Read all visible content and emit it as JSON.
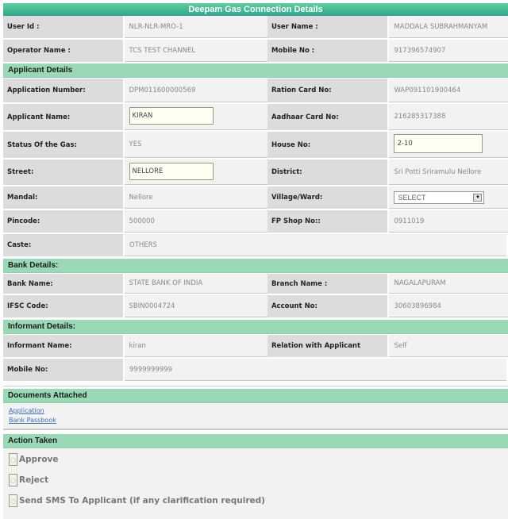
{
  "title": "Deepam Gas Connection Details",
  "header_rows": [
    {
      "label1": "User Id :",
      "value1": "NLR-NLR-MRO-1",
      "label2": "User Name :",
      "value2": "MADDALA SUBRAHMANYAM"
    },
    {
      "label1": "Operator Name :",
      "value1": "TCS TEST CHANNEL",
      "label2": "Mobile No :",
      "value2": "917396574907"
    }
  ],
  "applicant": {
    "section_title": "Applicant Details",
    "application_number_label": "Application Number:",
    "application_number": "DPM011600000569",
    "ration_card_label": "Ration Card No:",
    "ration_card": "WAP091101900464",
    "applicant_name_label": "Applicant Name:",
    "applicant_name": "KIRAN",
    "aadhaar_label": "Aadhaar Card No:",
    "aadhaar": "216285317388",
    "gas_status_label": "Status Of the Gas:",
    "gas_status": "YES",
    "house_no_label": "House No:",
    "house_no": "2-10",
    "street_label": "Street:",
    "street": "NELLORE",
    "district_label": "District:",
    "district": "Sri Potti Sriramulu Nellore",
    "mandal_label": "Mandal:",
    "mandal": "Nellore",
    "village_label": "Village/Ward:",
    "village_selected": "SELECT",
    "pincode_label": "Pincode:",
    "pincode": "500000",
    "fp_shop_label": "FP Shop No::",
    "fp_shop": "0911019",
    "caste_label": "Caste:",
    "caste": "OTHERS"
  },
  "bank": {
    "section_title": "Bank Details:",
    "bank_name_label": "Bank Name:",
    "bank_name": "STATE BANK OF INDIA",
    "branch_label": "Branch Name :",
    "branch": "NAGALAPURAM",
    "ifsc_label": "IFSC Code:",
    "ifsc": "SBIN0004724",
    "account_label": "Account No:",
    "account": "30603896984"
  },
  "informant": {
    "section_title": "Informant Details:",
    "name_label": "Informant Name:",
    "name": "kiran",
    "relation_label": "Relation with Applicant",
    "relation": "Self",
    "mobile_label": "Mobile No:",
    "mobile": "9999999999"
  },
  "documents": {
    "section_title": "Documents Attached",
    "links": [
      "Application",
      "Bank Passbook"
    ]
  },
  "actions": {
    "section_title": "Action Taken",
    "options": [
      "Approve",
      "Reject",
      "Send SMS To Applicant (if any clarification required)"
    ]
  },
  "colors": {
    "title_gradient_top": "#5fcf9e",
    "title_gradient_bottom": "#2fa58c",
    "section_header": "#9ad9b6",
    "label_bg": "#dcdcdc",
    "value_bg": "#f2f2f2",
    "link": "#3a6fc4"
  }
}
